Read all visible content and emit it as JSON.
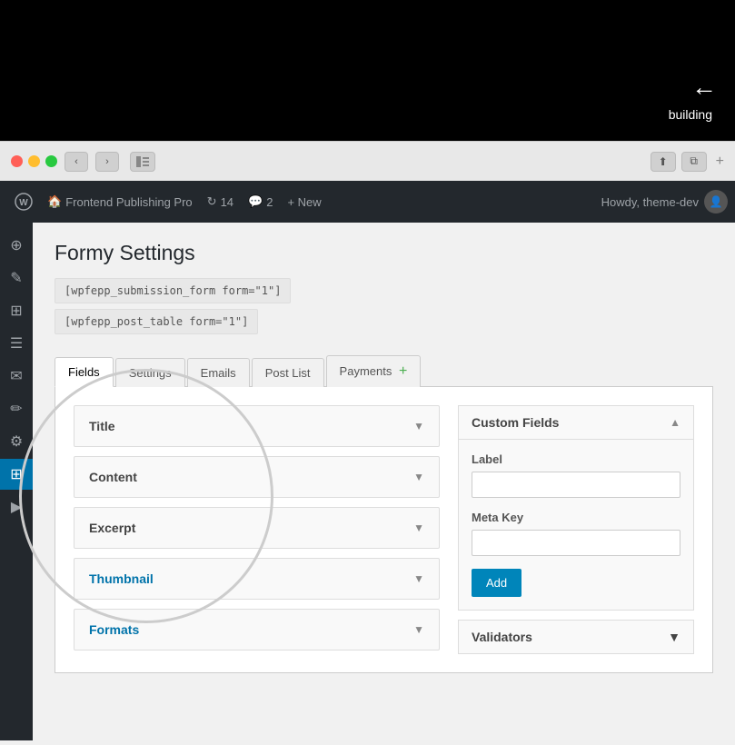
{
  "top_bar": {
    "icon": "←",
    "sub_text": "building"
  },
  "browser": {
    "nav_back": "‹",
    "nav_forward": "›",
    "share_icon": "⬆",
    "window_icon": "⧉",
    "plus_icon": "+"
  },
  "admin_bar": {
    "wp_logo": "W",
    "site_name": "Frontend Publishing Pro",
    "updates_label": "14",
    "comments_label": "2",
    "new_label": "+ New",
    "howdy": "Howdy, theme-dev"
  },
  "sidebar": {
    "items": [
      {
        "icon": "⊕",
        "name": "dashboard"
      },
      {
        "icon": "✎",
        "name": "posts"
      },
      {
        "icon": "⊞",
        "name": "plugins"
      },
      {
        "icon": "☰",
        "name": "pages"
      },
      {
        "icon": "✉",
        "name": "comments"
      },
      {
        "icon": "✏",
        "name": "edit"
      },
      {
        "icon": "⚙",
        "name": "settings"
      },
      {
        "icon": "⊞",
        "name": "tools"
      },
      {
        "icon": "▶",
        "name": "media"
      }
    ],
    "active_index": 7
  },
  "page": {
    "title": "Formy Settings",
    "shortcode1": "[wpfepp_submission_form form=\"1\"]",
    "shortcode2": "[wpfepp_post_table form=\"1\"]"
  },
  "tabs": [
    {
      "label": "Fields",
      "active": true
    },
    {
      "label": "Settings",
      "active": false
    },
    {
      "label": "Emails",
      "active": false
    },
    {
      "label": "Post List",
      "active": false
    },
    {
      "label": "Payments",
      "active": false,
      "has_plus": true
    }
  ],
  "fields": [
    {
      "label": "Title",
      "accent": false
    },
    {
      "label": "Content",
      "accent": false
    },
    {
      "label": "Excerpt",
      "accent": false
    },
    {
      "label": "Thumbnail",
      "accent": true
    },
    {
      "label": "Formats",
      "accent": true
    }
  ],
  "custom_fields": {
    "header": "Custom Fields",
    "label_label": "Label",
    "label_placeholder": "",
    "meta_key_label": "Meta Key",
    "meta_key_placeholder": "",
    "add_button": "Add"
  },
  "validators": {
    "header": "Validators"
  }
}
